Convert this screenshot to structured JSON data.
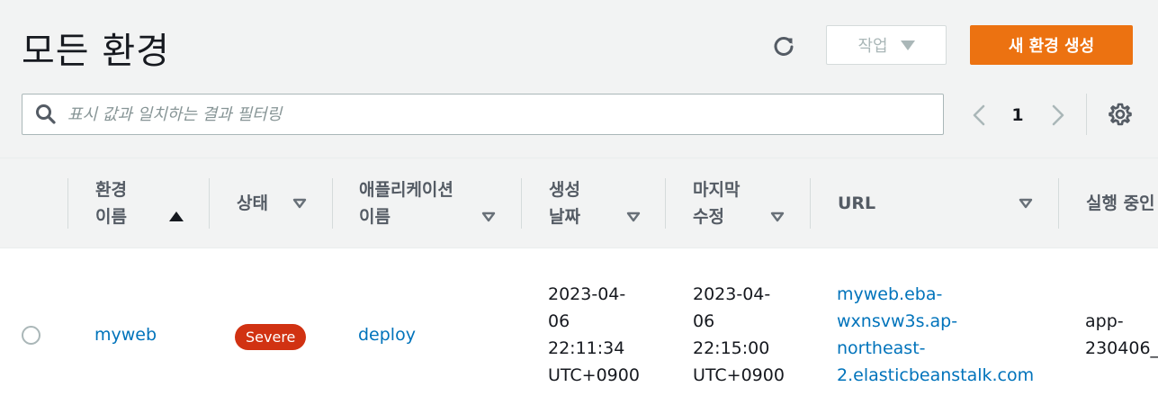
{
  "header": {
    "title": "모든 환경",
    "actions_label": "작업",
    "create_label": "새 환경 생성"
  },
  "filter": {
    "placeholder": "표시 값과 일치하는 결과 필터링",
    "value": ""
  },
  "pagination": {
    "current_page": "1"
  },
  "table": {
    "columns": [
      {
        "label": "환경\n이름",
        "sort": "ascending"
      },
      {
        "label": "상태",
        "sort": "none"
      },
      {
        "label": "애플리케이션\n이름",
        "sort": "none"
      },
      {
        "label": "생성\n날짜",
        "sort": "none"
      },
      {
        "label": "마지막\n수정",
        "sort": "none"
      },
      {
        "label": "URL",
        "sort": "none"
      },
      {
        "label": "실행 중인"
      }
    ],
    "rows": [
      {
        "environment_name": "myweb",
        "status": "Severe",
        "application_name": "deploy",
        "created": "2023-04-\n06\n22:11:34\nUTC+0900",
        "modified": "2023-04-\n06\n22:15:00\nUTC+0900",
        "url": "myweb.eba-\nwxnsvw3s.ap-\nnortheast-\n2.elasticbeanstalk.com",
        "running_version": "app-\n230406_"
      }
    ]
  },
  "colors": {
    "primary_button": "#ec7211",
    "link": "#0073bb",
    "severe_badge": "#d13212",
    "header_bg": "#f2f3f3"
  },
  "icons": {
    "refresh": "refresh-icon",
    "search": "search-icon",
    "prev": "chevron-left-icon",
    "next": "chevron-right-icon",
    "settings": "gear-icon"
  }
}
